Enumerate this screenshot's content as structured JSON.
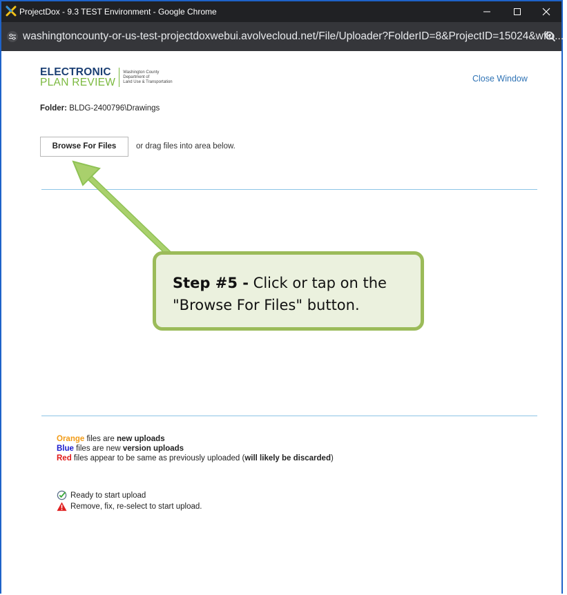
{
  "window": {
    "title": "ProjectDox - 9.3 TEST Environment - Google Chrome",
    "url": "washingtoncounty-or-us-test-projectdoxwebui.avolvecloud.net/File/Uploader?FolderID=8&ProjectID=15024&wflo..."
  },
  "header": {
    "logo_line1": "ELECTRONIC",
    "logo_line2": "PLAN REVIEW",
    "logo_org1": "Washington County",
    "logo_org2": "Department of",
    "logo_org3": "Land Use & Transportation",
    "close_window": "Close Window"
  },
  "folder": {
    "label": "Folder:",
    "path": "BLDG-2400796\\Drawings"
  },
  "upload": {
    "browse_label": "Browse For Files",
    "drag_text": "or drag files into area below."
  },
  "legend": {
    "orange_word": "Orange",
    "orange_mid": " files are ",
    "orange_bold": "new uploads",
    "blue_word": "Blue",
    "blue_mid": " files are new ",
    "blue_bold": "version uploads",
    "red_word": "Red",
    "red_mid": " files appear to be same as previously uploaded (",
    "red_bold": "will likely be discarded",
    "red_end": ")"
  },
  "status": {
    "ready": "Ready to start upload",
    "fix": "Remove, fix, re-select to start upload."
  },
  "callout": {
    "step": "Step #5 -",
    "text_line1": " Click or tap on the",
    "text_line2": "\"Browse For Files\" button."
  },
  "colors": {
    "callout_fill": "#ebf1de",
    "callout_border": "#9bbb59",
    "orange": "#f29b16",
    "blue": "#1a1acd",
    "red": "#e01818"
  }
}
